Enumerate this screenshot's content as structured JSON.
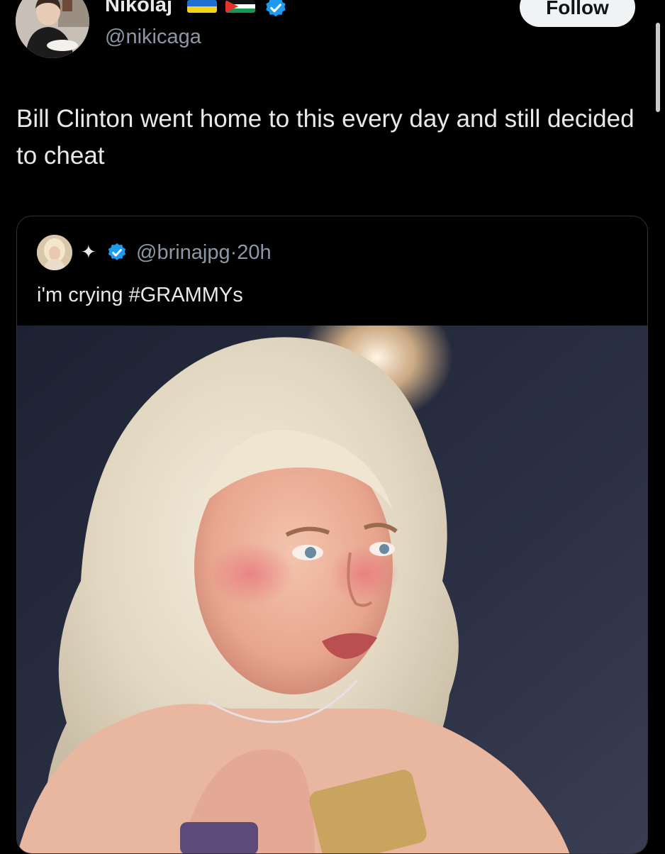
{
  "tweet": {
    "author": {
      "display_name": "Nikolaj",
      "handle": "@nikicaga",
      "flags": [
        "ukraine-flag",
        "palestine-flag"
      ],
      "verified": true
    },
    "follow_label": "Follow",
    "text": "Bill Clinton went home to this every day and still decided to cheat"
  },
  "quote": {
    "badge": "✦",
    "verified": true,
    "handle": "@brinajpg",
    "separator": "·",
    "time": "20h",
    "text": "i'm crying #GRAMMYs"
  },
  "colors": {
    "background": "#000000",
    "text": "#e7e9ea",
    "secondary_text": "#8b98a5",
    "verified_blue": "#1d9bf0",
    "card_border": "#2f3336",
    "follow_button_bg": "#eff3f4"
  }
}
